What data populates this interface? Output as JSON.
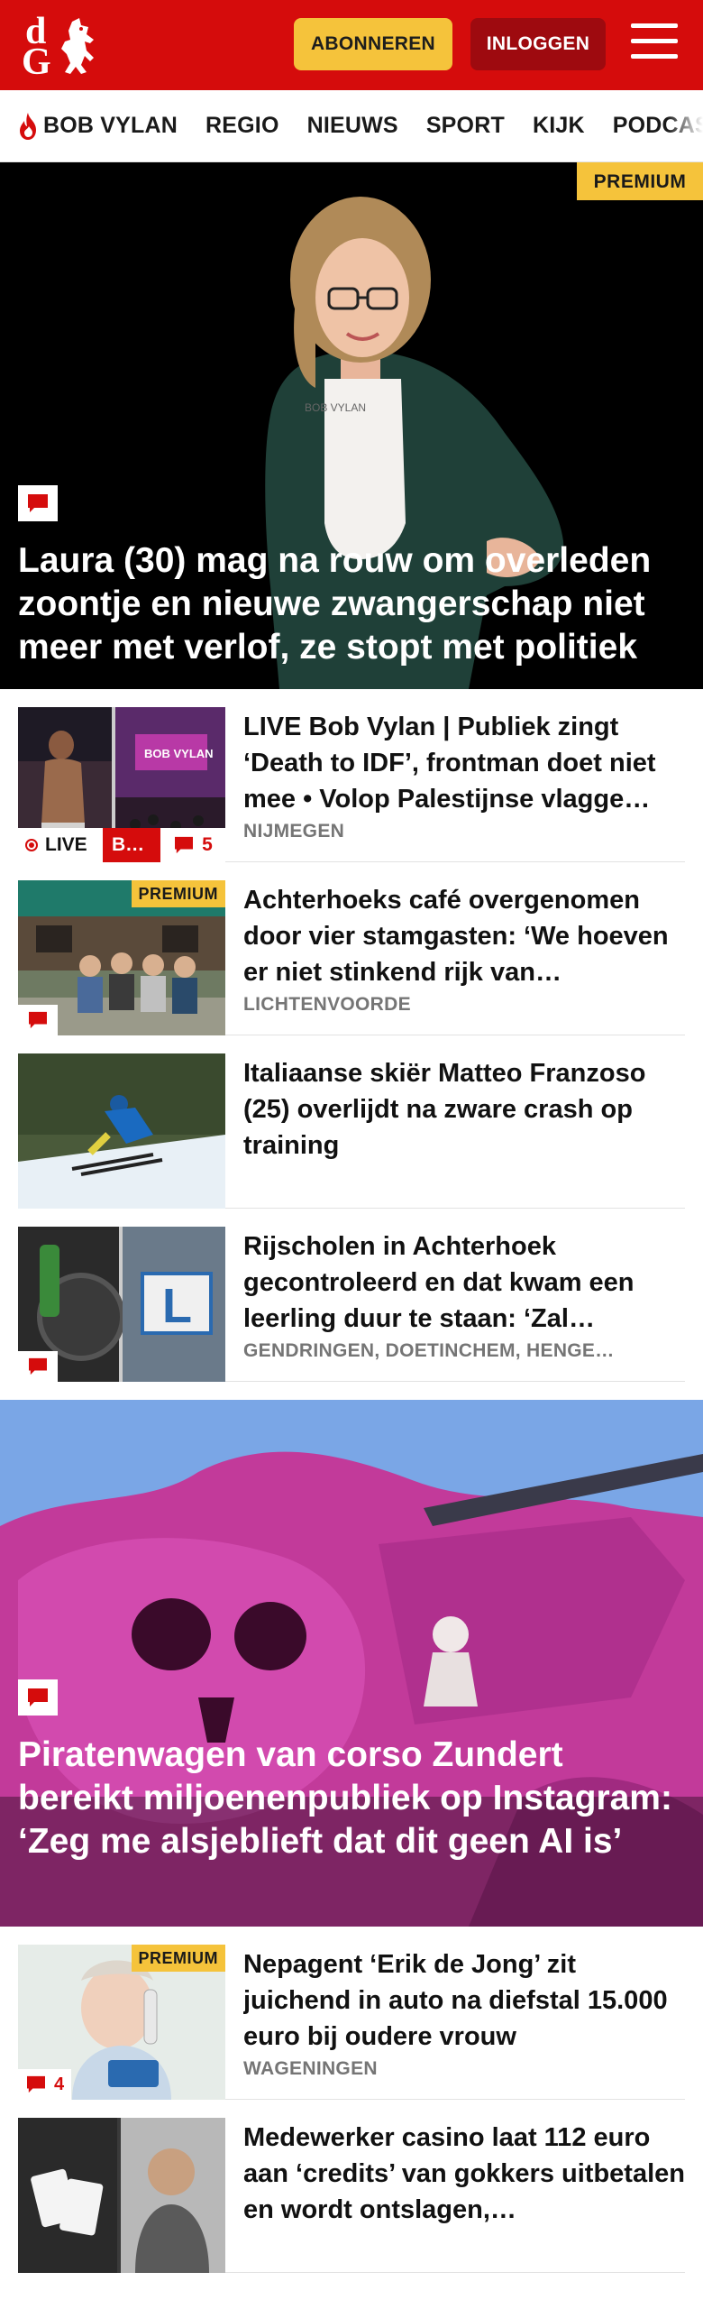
{
  "header": {
    "logo_top": "d",
    "logo_bottom": "G",
    "subscribe_label": "ABONNEREN",
    "login_label": "INLOGGEN"
  },
  "nav": {
    "items": [
      {
        "label": "BOB VYLAN",
        "icon": "flame-icon"
      },
      {
        "label": "REGIO"
      },
      {
        "label": "NIEUWS"
      },
      {
        "label": "SPORT"
      },
      {
        "label": "KIJK"
      },
      {
        "label": "PODCAS"
      }
    ]
  },
  "hero": {
    "premium": "PREMIUM",
    "title": "Laura (30) mag na rouw om overleden zoontje en nieuwe zwangerschap niet meer met verlof, ze stopt met politiek"
  },
  "articles": [
    {
      "title": "LIVE Bob Vylan | Publiek zingt ‘Death to IDF’, frontman doet niet mee • Volop Palestijnse vlagge…",
      "meta": "NIJMEGEN",
      "live": "LIVE",
      "live_tag": "B…",
      "comments": "5"
    },
    {
      "title": "Achterhoeks café overgenomen door vier stamgasten: ‘We hoeven er niet stinkend rijk van…",
      "meta": "LICHTENVOORDE",
      "premium": "PREMIUM"
    },
    {
      "title": "Italiaanse skiër Matteo Franzoso (25) overlijdt na zware crash op training",
      "meta": ""
    },
    {
      "title": "Rijscholen in Achterhoek gecontroleerd en dat kwam een leerling duur te staan: ‘Zal…",
      "meta": "GENDRINGEN, DOETINCHEM, HENGE…"
    }
  ],
  "hero2": {
    "title": "Piratenwagen van corso Zundert bereikt miljoenenpubliek op Instagram: ‘Zeg me alsjeblieft dat dit geen AI is’"
  },
  "articles2": [
    {
      "title": "Nepagent ‘Erik de Jong’ zit juichend in auto na diefstal 15.000 euro bij oudere vrouw",
      "meta": "WAGENINGEN",
      "premium": "PREMIUM",
      "comments": "4"
    },
    {
      "title": "Medewerker casino laat 112 euro aan ‘credits’ van gokkers uitbetalen en wordt ontslagen,…",
      "meta": ""
    }
  ],
  "colors": {
    "brand_red": "#d50c0c",
    "premium_yellow": "#f5c33b",
    "login_dark_red": "#9e0a0f"
  }
}
